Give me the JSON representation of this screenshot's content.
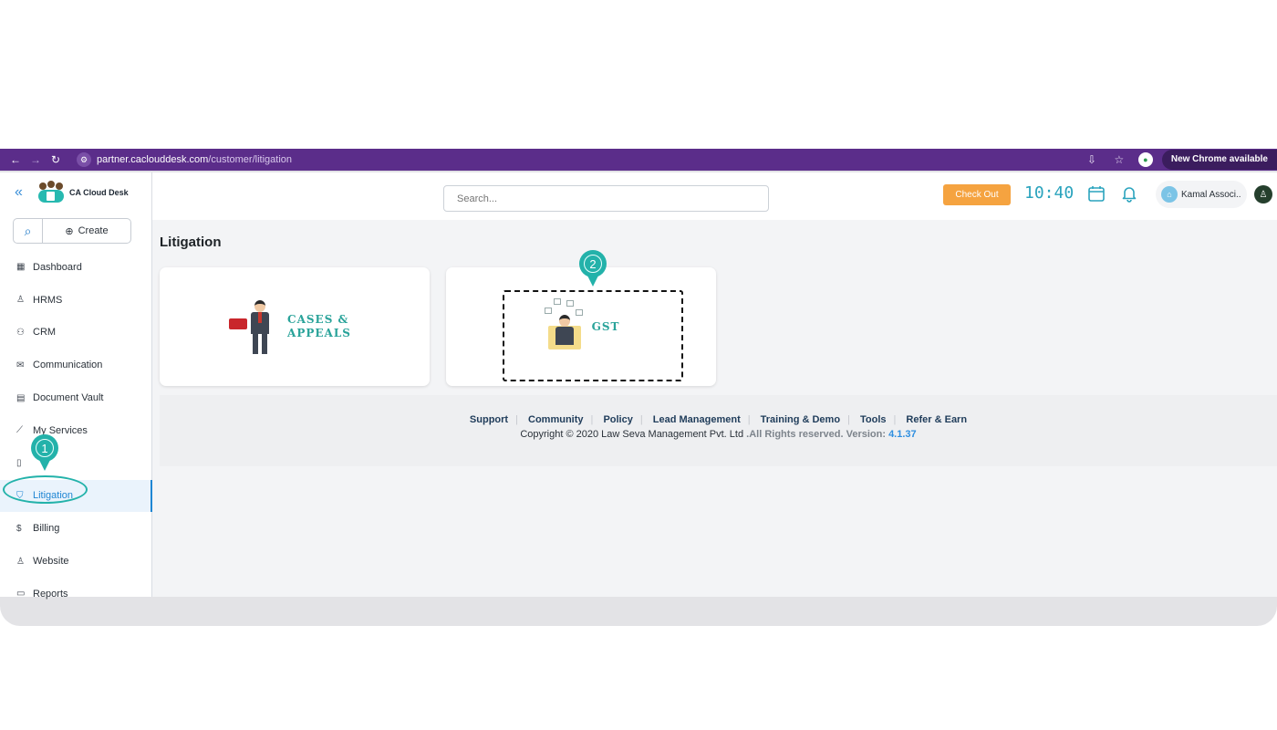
{
  "browser": {
    "url_host": "partner.caclouddesk.com",
    "url_path": "/customer/litigation",
    "update_label": "New Chrome available"
  },
  "brand": {
    "name": "CA Cloud Desk"
  },
  "sidebar": {
    "create_label": "Create",
    "items": [
      {
        "label": "Dashboard",
        "icon": "grid-icon"
      },
      {
        "label": "HRMS",
        "icon": "user-icon"
      },
      {
        "label": "CRM",
        "icon": "users-icon"
      },
      {
        "label": "Communication",
        "icon": "mail-icon"
      },
      {
        "label": "Document Vault",
        "icon": "document-icon"
      },
      {
        "label": "My Services",
        "icon": "chart-icon"
      },
      {
        "label": "",
        "icon": "file-icon"
      },
      {
        "label": "Litigation",
        "icon": "shield-icon",
        "active": true
      },
      {
        "label": "Billing",
        "icon": "dollar-icon"
      },
      {
        "label": "Website",
        "icon": "user-icon"
      },
      {
        "label": "Reports",
        "icon": "image-icon"
      }
    ]
  },
  "header": {
    "search_placeholder": "Search...",
    "checkout_label": "Check Out",
    "time": "10:40",
    "user_name": "Kamal Associ.."
  },
  "page": {
    "title": "Litigation",
    "cards": [
      {
        "line1": "CASES &",
        "line2": "APPEALS"
      },
      {
        "line1": "GST"
      }
    ]
  },
  "footer": {
    "links": [
      "Support",
      "Community",
      "Policy",
      "Lead Management",
      "Training & Demo",
      "Tools",
      "Refer & Earn"
    ],
    "copyright": "Copyright © 2020 Law Seva Management Pvt. Ltd",
    "rights": ".All Rights reserved.",
    "version_label": "Version:",
    "version": "4.1.37"
  },
  "annotations": {
    "pin1": "1",
    "pin2": "2"
  },
  "colors": {
    "browser": "#5b2d8a",
    "accent": "#23b2aa",
    "checkout": "#f5a340",
    "active": "#1f86d3"
  }
}
